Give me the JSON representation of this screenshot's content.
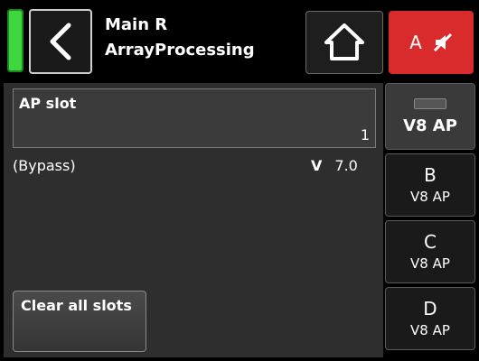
{
  "header": {
    "title_line1": "Main R",
    "title_line2": "ArrayProcessing",
    "mute_channel": "A"
  },
  "main": {
    "slot_label": "AP slot",
    "slot_value": "1",
    "bypass_text": "(Bypass)",
    "version_prefix": "V",
    "version_value": "7.0",
    "clear_button_label": "Clear all slots"
  },
  "tabs": [
    {
      "label": "V8 AP"
    },
    {
      "letter": "B",
      "sub": "V8 AP"
    },
    {
      "letter": "C",
      "sub": "V8 AP"
    },
    {
      "letter": "D",
      "sub": "V8 AP"
    }
  ],
  "icons": {
    "back": "back-arrow-icon",
    "home": "home-icon",
    "mute": "speaker-muted-icon"
  },
  "colors": {
    "led": "#3fd63f",
    "mute_button": "#d92b2b"
  }
}
